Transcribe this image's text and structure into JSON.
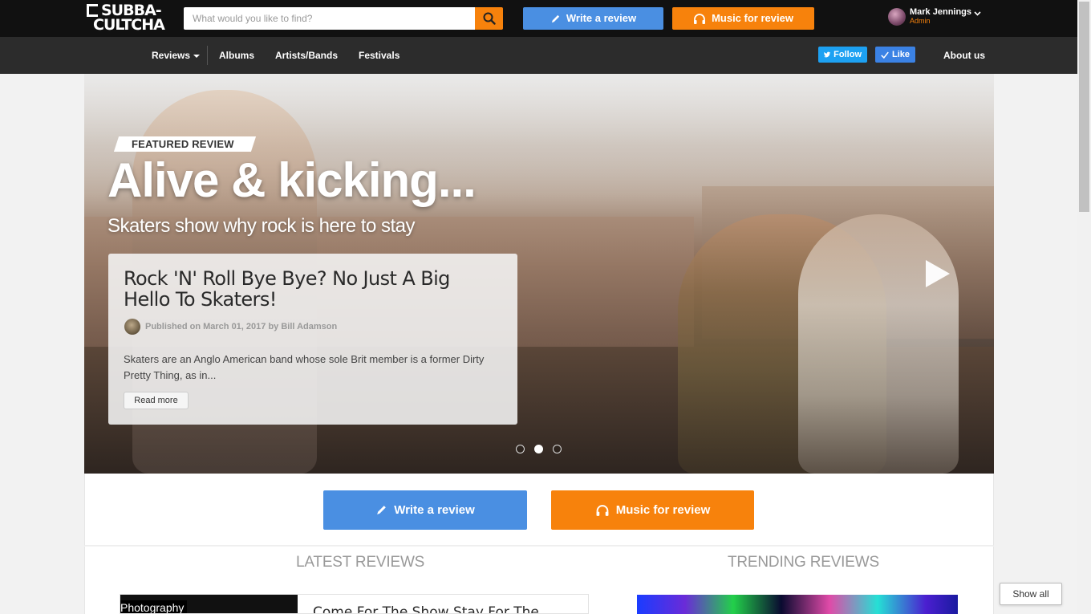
{
  "header": {
    "logo": {
      "line1": "SUBBA-",
      "line2": "CULTCHA"
    },
    "search": {
      "placeholder": "What would you like to find?",
      "value": ""
    },
    "write_review_label": "Write a review",
    "music_review_label": "Music for review",
    "user": {
      "name": "Mark Jennings",
      "role": "Admin"
    }
  },
  "nav": {
    "items": [
      {
        "label": "Reviews",
        "has_dropdown": true
      },
      {
        "label": "Albums"
      },
      {
        "label": "Artists/Bands"
      },
      {
        "label": "Festivals"
      }
    ],
    "twitter_label": "Follow",
    "facebook_label": "Like",
    "about_label": "About us"
  },
  "hero": {
    "tag": "FEATURED REVIEW",
    "title": "Alive & kicking...",
    "subtitle": "Skaters show why rock is here to stay",
    "card": {
      "title": "Rock 'N' Roll Bye Bye? No Just A Big Hello To Skaters!",
      "meta": "Published on March 01, 2017 by Bill Adamson",
      "excerpt": "Skaters are an Anglo American band whose sole Brit member is a former Dirty Pretty Thing, as in...",
      "read_more": "Read more"
    },
    "slides": {
      "count": 3,
      "active_index": 1
    }
  },
  "cta": {
    "write_review_label": "Write a review",
    "music_review_label": "Music for review"
  },
  "sections": {
    "latest_heading": "LATEST REVIEWS",
    "trending_heading": "TRENDING REVIEWS",
    "latest_item": {
      "category": "Photography",
      "title": "Come For The Show Stay For The"
    },
    "show_all": "Show all"
  },
  "colors": {
    "brand_orange": "#f7820c",
    "brand_blue": "#4a8fe2",
    "topbar_bg": "#111111",
    "navbar_bg": "#2c2c2c",
    "twitter_blue": "#1da1f2"
  },
  "icons": {
    "search": "search-icon",
    "pencil": "pencil-icon",
    "headphones": "headphones-icon",
    "chevron": "chevron-down-icon",
    "twitter": "twitter-icon",
    "facebook_like": "check-icon",
    "next": "next-arrow-icon"
  }
}
